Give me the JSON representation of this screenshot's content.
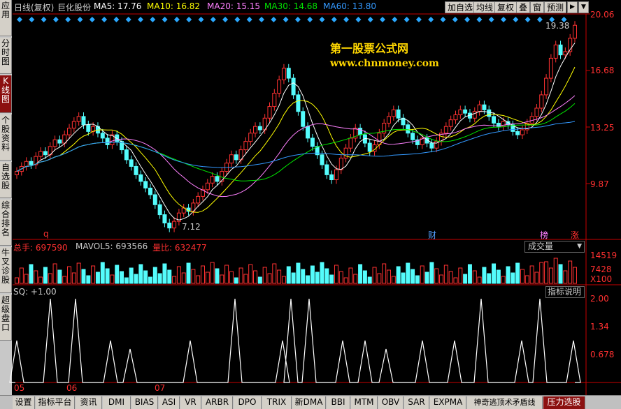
{
  "header": {
    "period": "日线(复权)",
    "stock": "巨化股份",
    "ma5": "MA5: 17.76",
    "ma10": "MA10: 16.82",
    "ma20": "MA20: 15.15",
    "ma30": "MA30: 14.68",
    "ma60": "MA60: 13.80",
    "buttons": [
      "加自选",
      "均线",
      "复权",
      "叠",
      "窗",
      "预测"
    ]
  },
  "sidebar": [
    {
      "label": "应用"
    },
    {
      "label": "分时图"
    },
    {
      "label": "K线图"
    },
    {
      "label": "个股资料"
    },
    {
      "label": "自选股"
    },
    {
      "label": "综合排名"
    },
    {
      "label": "牛叉诊股"
    },
    {
      "label": "超级盘口"
    }
  ],
  "watermark": {
    "line1": "第一股票公式网",
    "line2": "www.chnmoney.com"
  },
  "price_axis": [
    "20.06",
    "16.68",
    "13.25",
    "9.87"
  ],
  "annotations": {
    "high": "19.38",
    "low": "7.12",
    "marker_q": "q",
    "marker_cai": "财",
    "marker_bang": "榜",
    "marker_zhang": "涨"
  },
  "volume_panel": {
    "total": "总手: 697590",
    "mavol": "MAVOL5: 693566",
    "ratio": "量比: 632477",
    "selector": "成交量",
    "axis": [
      "14519",
      "7428",
      "X100"
    ]
  },
  "indicator_panel": {
    "title": "SQ: +1.00",
    "help": "指标说明",
    "axis": [
      "2.00",
      "1.34",
      "0.678"
    ]
  },
  "months": [
    "05",
    "06",
    "07"
  ],
  "bottom_tabs": [
    "设置",
    "指标平台",
    "资讯",
    "DMI",
    "BIAS",
    "ASI",
    "VR",
    "ARBR",
    "DPO",
    "TRIX",
    "新DMA",
    "BBI",
    "MTM",
    "OBV",
    "SAR",
    "EXPMA",
    "神奇逃顶术矛盾线",
    "压力选股"
  ],
  "colors": {
    "up": "#ff3232",
    "down": "#54fcfc",
    "ma5": "#ffffff",
    "ma10": "#ffff00",
    "ma20": "#ff80ff",
    "ma30": "#00e600",
    "ma60": "#3399ff",
    "grid": "#c80000"
  }
}
